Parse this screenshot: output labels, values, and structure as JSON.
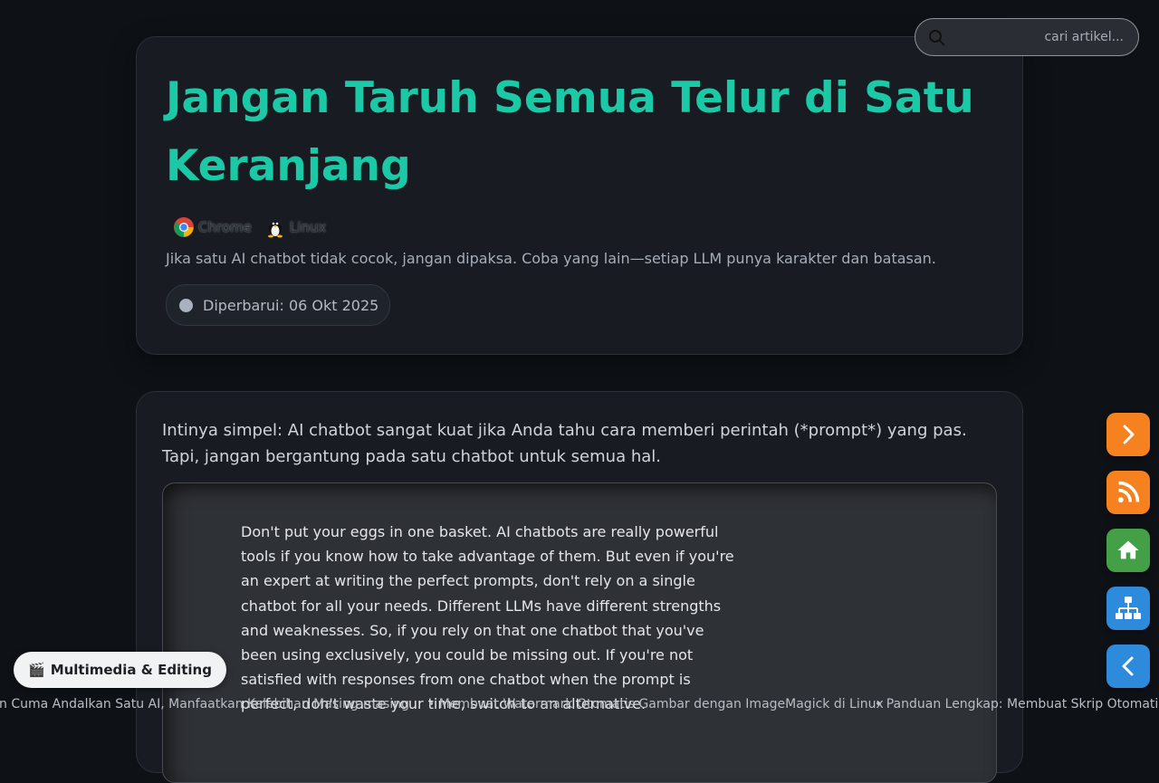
{
  "search": {
    "placeholder": "cari artikel..."
  },
  "header": {
    "title": "Jangan Taruh Semua Telur di Satu Keranjang",
    "platforms": [
      {
        "label": "Chrome",
        "icon": "chrome-icon"
      },
      {
        "label": "Linux",
        "icon": "linux-tux-icon"
      }
    ],
    "subtitle": "Jika satu AI chatbot tidak cocok, jangan dipaksa. Coba yang lain—setiap LLM punya karakter dan batasan.",
    "updated": "Diperbarui: 06 Okt 2025"
  },
  "article": {
    "intro": "Intinya simpel: AI chatbot sangat kuat jika Anda tahu cara memberi perintah (*prompt*) yang pas. Tapi, jangan bergantung pada satu chatbot untuk semua hal.",
    "quote": "Don't put your eggs in one basket. AI chatbots are really powerful tools if you know how to take advantage of them. But even if you're an expert at writing the perfect prompts, don't rely on a single chatbot for all your needs. Different LLMs have different strengths and weaknesses. So, if you rely on that one chatbot that you've been using exclusively, you could be missing out. If you're not satisfied with responses from one chatbot when the prompt is perfect, don't waste your time, switch to an alternative."
  },
  "sidebar_buttons": [
    {
      "name": "next",
      "icon": "chevron-right-icon",
      "color": "#f5821f"
    },
    {
      "name": "rss",
      "icon": "rss-icon",
      "color": "#f5821f"
    },
    {
      "name": "home",
      "icon": "home-icon",
      "color": "#43a047"
    },
    {
      "name": "sitemap",
      "icon": "sitemap-icon",
      "color": "#2e8bdc"
    },
    {
      "name": "prev",
      "icon": "chevron-left-icon",
      "color": "#2e8bdc"
    }
  ],
  "category": {
    "icon": "🎬",
    "label": "Multimedia & Editing"
  },
  "ticker": {
    "items": [
      "Jangan Cuma Andalkan Satu AI, Manfaatkan Kelebihan Masing-masing",
      "• Membuat Watermark Otomatis Gambar dengan ImageMagick di Linux",
      "• Panduan Lengkap: Membuat Skrip Otomatisasi"
    ]
  },
  "colors": {
    "accent": "#1bc9a6",
    "background": "#0e1217",
    "card": "#181c22"
  }
}
